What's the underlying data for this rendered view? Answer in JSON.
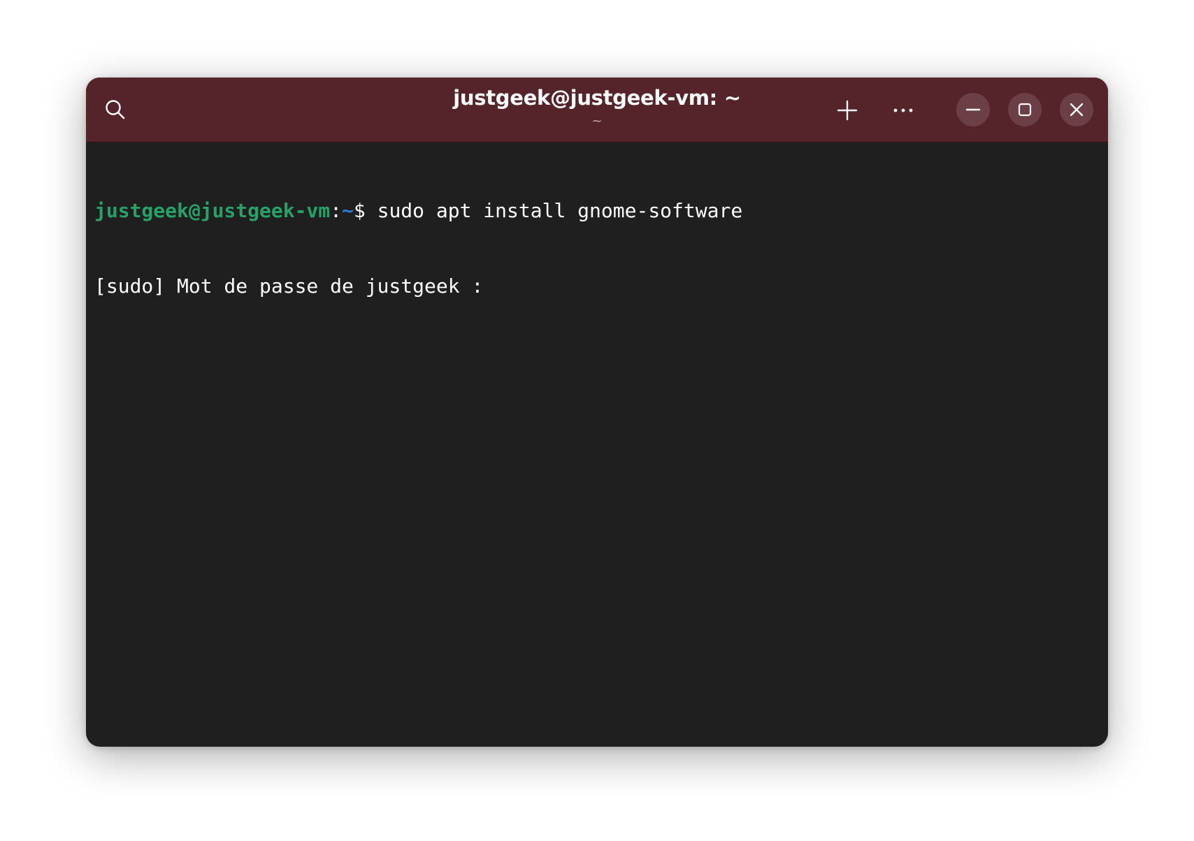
{
  "window": {
    "title": "justgeek@justgeek-vm: ~",
    "subtitle": "~"
  },
  "headerbar": {
    "icons": {
      "search": "search-icon",
      "new_tab": "plus-icon",
      "menu": "more-horizontal-icon",
      "minimize": "minimize-icon",
      "maximize": "maximize-icon",
      "close": "close-icon"
    },
    "background_color": "#55232a"
  },
  "terminal": {
    "background_color": "#1f1f1f",
    "prompt": {
      "user_host": "justgeek@justgeek-vm",
      "colon": ":",
      "path": "~",
      "symbol": "$",
      "user_host_color": "#26a269",
      "path_color": "#2a7bde"
    },
    "command": " sudo apt install gnome-software",
    "output_lines": [
      "[sudo] Mot de passe de justgeek : "
    ]
  }
}
